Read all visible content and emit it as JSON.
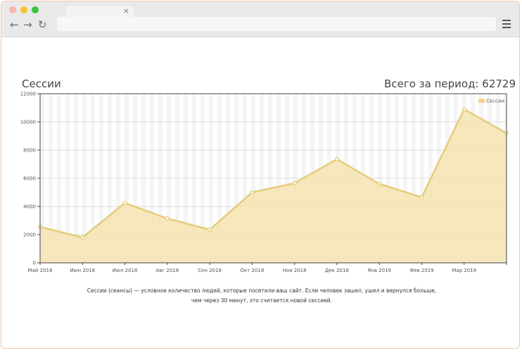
{
  "browser": {
    "close_glyph": "×",
    "icons": [
      "back-arrow-icon",
      "forward-arrow-icon",
      "reload-icon",
      "hamburger-menu-icon"
    ]
  },
  "page": {
    "title": "Сессии",
    "total_label": "Всего за период: 62729",
    "note": "Сессии (сеансы) — условное количество людей, которые посетили ваш сайт. Если человек зашел, ушел и вернулся больше, чем через 30 минут, это считается новой сессией."
  },
  "colors": {
    "line": "#e5cc7a",
    "fill": "#f4e3b2",
    "point_fill": "#ffffff",
    "legend_box": "#f0d38c"
  },
  "chart_data": {
    "type": "area",
    "categories": [
      "Май 2018",
      "Июн 2018",
      "Июл 2018",
      "Авг 2018",
      "Сен 2018",
      "Окт 2018",
      "Ноя 2018",
      "Дек 2018",
      "Янв 2019",
      "Фев 2019",
      "Мар 2019",
      ""
    ],
    "series": [
      {
        "name": "Сессии",
        "values": [
          2550,
          1800,
          4250,
          3150,
          2350,
          5000,
          5650,
          7350,
          5600,
          4650,
          10900,
          9200
        ]
      }
    ],
    "ylim": [
      0,
      12000
    ],
    "yticks": [
      0,
      2000,
      4000,
      6000,
      8000,
      10000,
      12000
    ],
    "grid": true,
    "legend": "top-right"
  }
}
